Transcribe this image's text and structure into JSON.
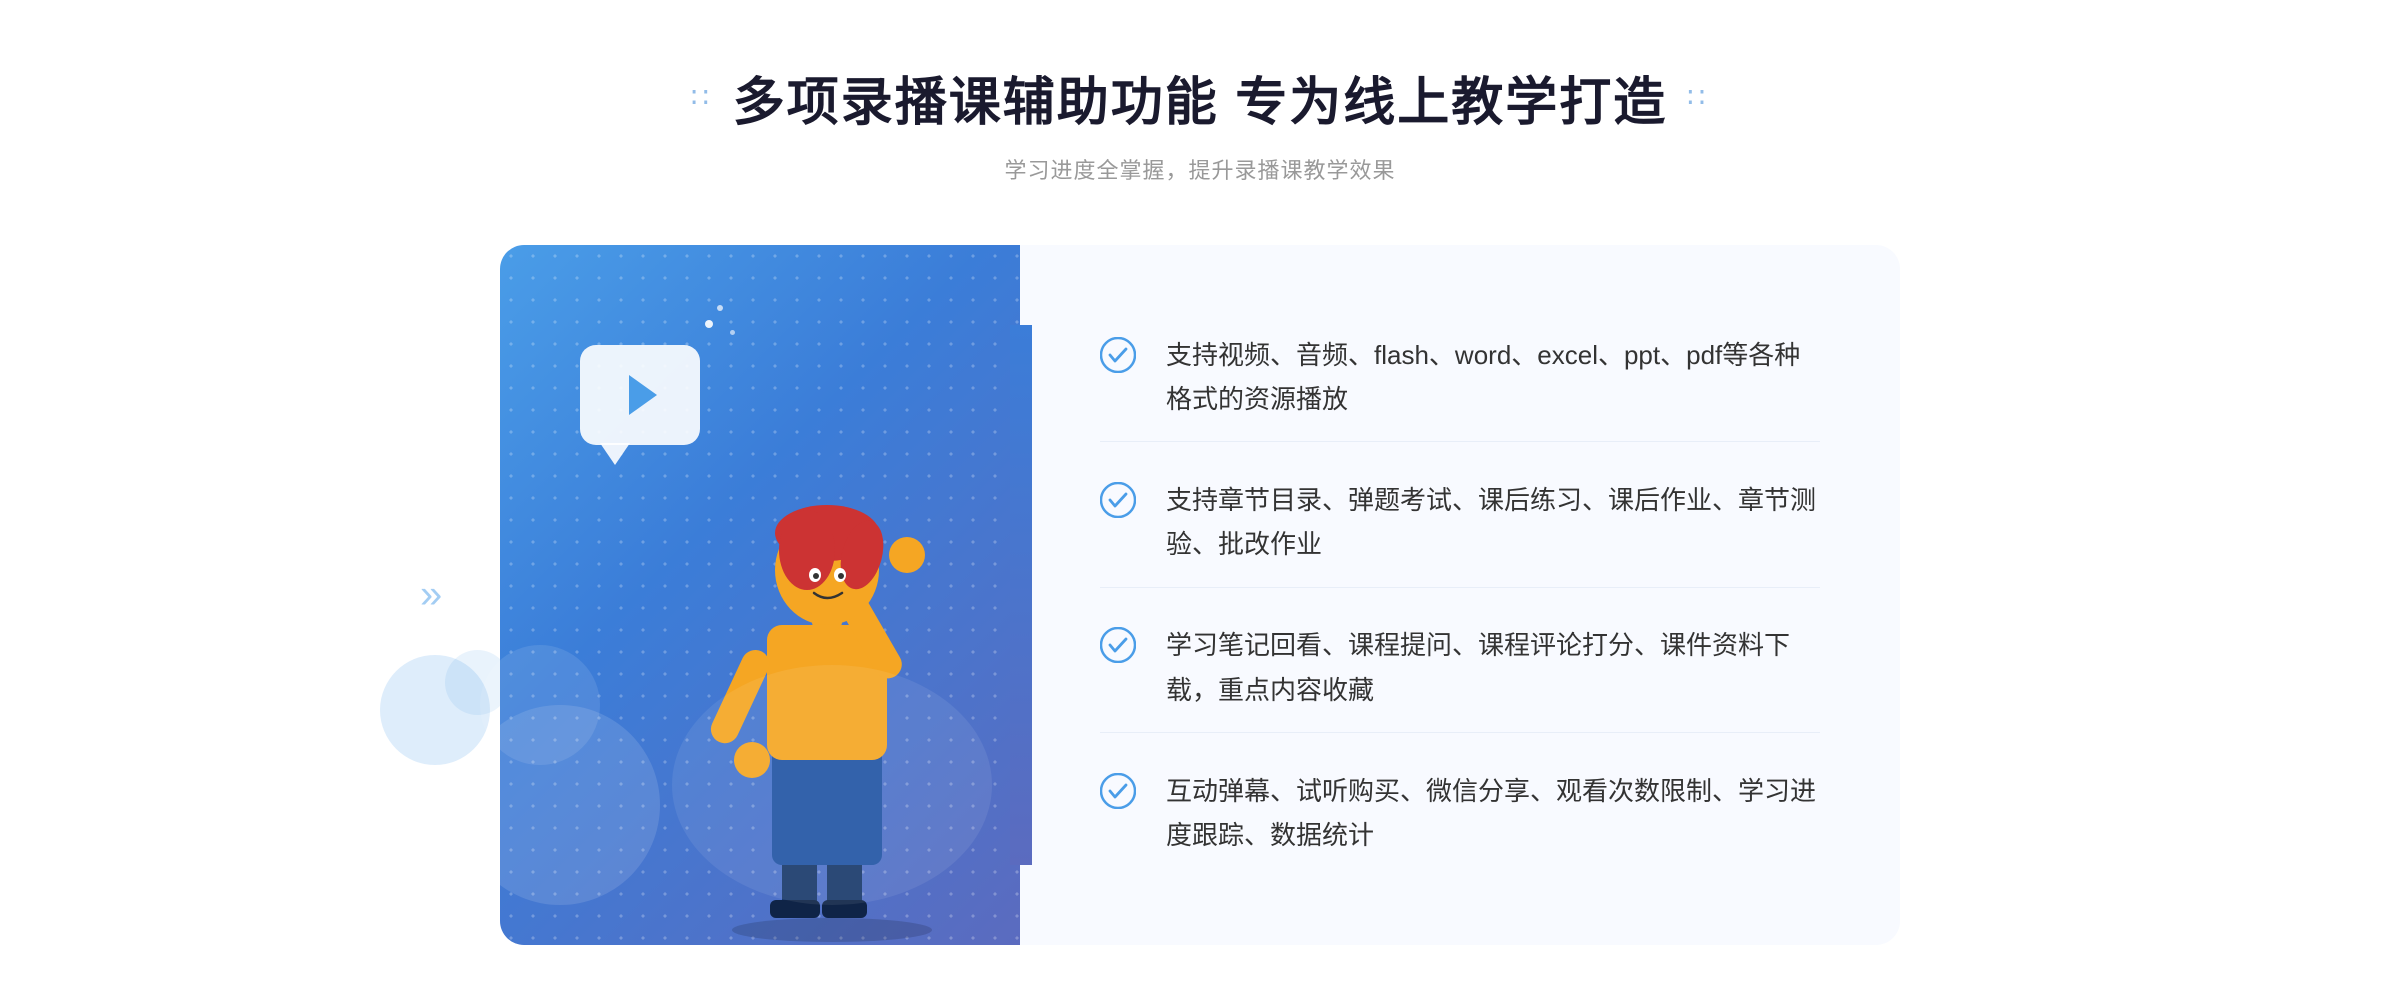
{
  "header": {
    "title": "多项录播课辅助功能 专为线上教学打造",
    "subtitle": "学习进度全掌握，提升录播课教学效果",
    "title_dots_left": "∷",
    "title_dots_right": "∷"
  },
  "features": [
    {
      "id": 1,
      "text": "支持视频、音频、flash、word、excel、ppt、pdf等各种格式的资源播放"
    },
    {
      "id": 2,
      "text": "支持章节目录、弹题考试、课后练习、课后作业、章节测验、批改作业"
    },
    {
      "id": 3,
      "text": "学习笔记回看、课程提问、课程评论打分、课件资料下载，重点内容收藏"
    },
    {
      "id": 4,
      "text": "互动弹幕、试听购买、微信分享、观看次数限制、学习进度跟踪、数据统计"
    }
  ],
  "colors": {
    "primary_blue": "#4a9de8",
    "dark_blue": "#3b7dd8",
    "title_color": "#1a1a2e",
    "subtitle_color": "#999999",
    "text_color": "#333333",
    "panel_bg": "#f8faff",
    "check_color": "#4a9de8"
  },
  "chevrons": "»"
}
